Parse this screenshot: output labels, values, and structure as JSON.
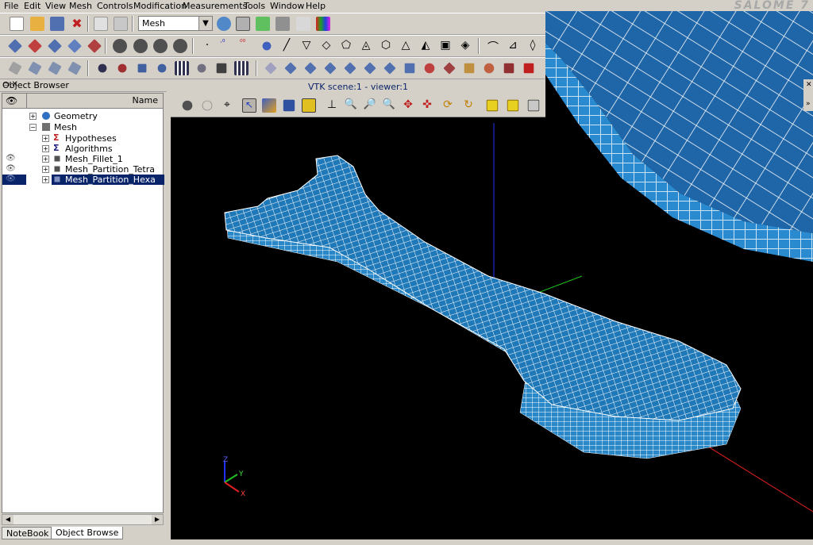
{
  "menu": [
    "File",
    "Edit",
    "View",
    "Mesh",
    "Controls",
    "Modification",
    "Measurements",
    "Tools",
    "Window",
    "Help"
  ],
  "brand": "SALOME 7",
  "module_combo": {
    "value": "Mesh"
  },
  "object_browser": {
    "title": "Object Browser",
    "column_name": "Name",
    "items": [
      {
        "label": "Geometry",
        "level": 0
      },
      {
        "label": "Mesh",
        "level": 0
      },
      {
        "label": "Hypotheses",
        "level": 1
      },
      {
        "label": "Algorithms",
        "level": 1
      },
      {
        "label": "Mesh_Fillet_1",
        "level": 1
      },
      {
        "label": "Mesh_Partition_Tetra",
        "level": 1
      },
      {
        "label": "Mesh_Partition_Hexa",
        "level": 1
      }
    ]
  },
  "tabs": [
    "NoteBook",
    "Object Browse"
  ],
  "viewer": {
    "title": "VTK scene:1 - viewer:1"
  },
  "axes": {
    "z": "Z",
    "y": "Y",
    "x": "X"
  },
  "colors": {
    "mesh_fill": "#1f78b8",
    "mesh_line": "#ffffff",
    "selection": "#0a246a",
    "background": "#000000"
  }
}
